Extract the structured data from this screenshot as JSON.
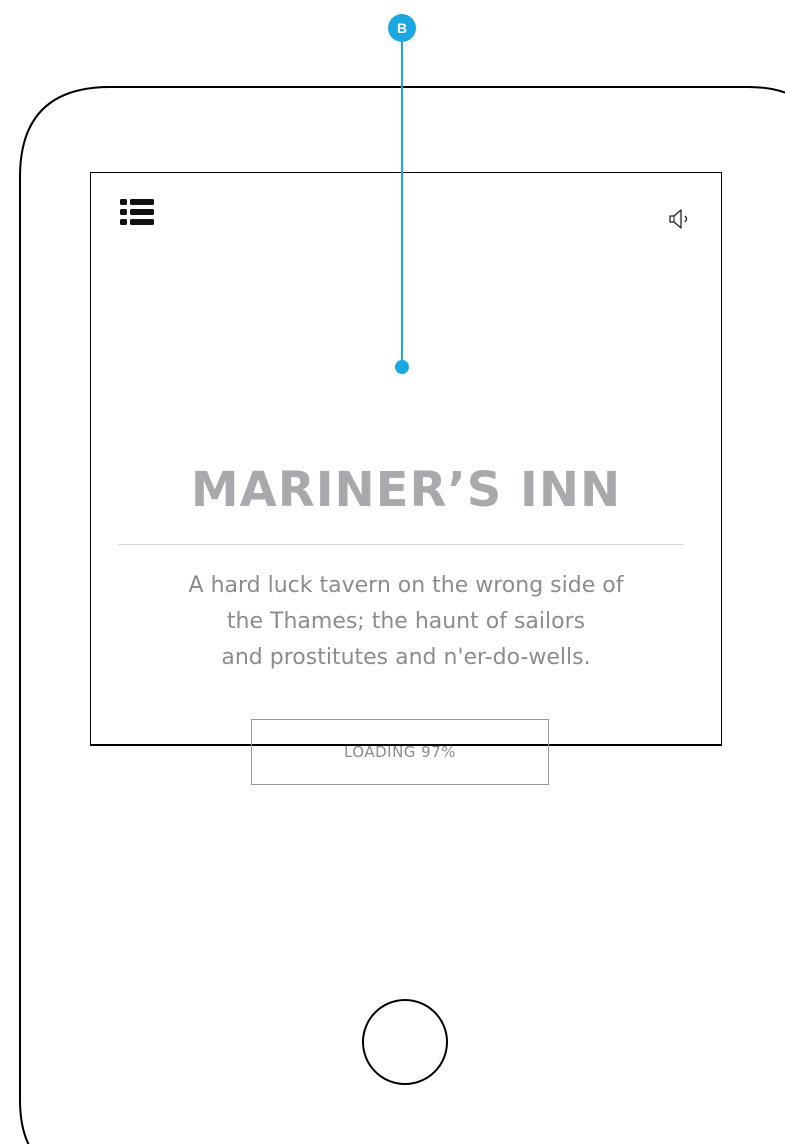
{
  "annotation": {
    "badge_label": "B",
    "color": "#1ba8e0"
  },
  "header": {
    "menu_icon": "list-menu-icon",
    "sound_icon": "speaker-icon"
  },
  "main": {
    "title": "MARINER’S INN",
    "description_lines": [
      "A hard luck tavern on the wrong side of",
      "the Thames; the haunt of sailors",
      "and prostitutes and n'er-do-wells."
    ],
    "loading_label": "LOADING 97%",
    "loading_progress_percent": 97
  },
  "device": {
    "home_button_icon": "home-button-icon"
  },
  "colors": {
    "title": "#a7a9ac",
    "body_text": "#8a8c8f",
    "frame": "#000000"
  }
}
